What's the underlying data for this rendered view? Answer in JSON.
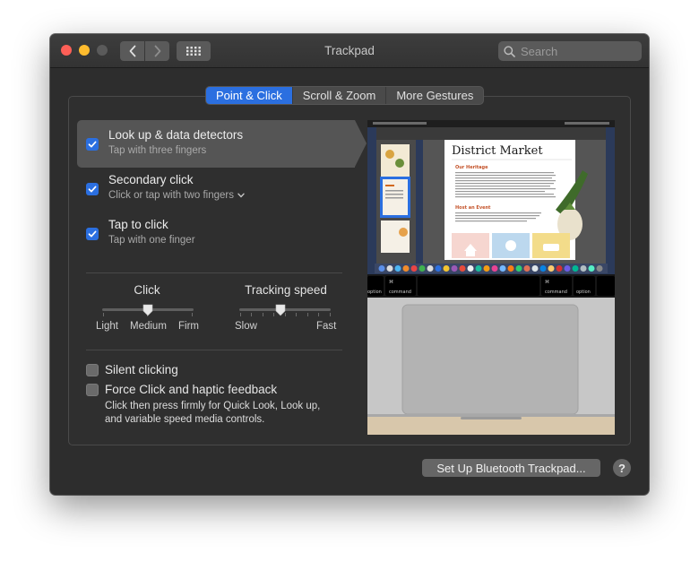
{
  "window": {
    "title": "Trackpad"
  },
  "toolbar": {
    "search_placeholder": "Search"
  },
  "tabs": [
    {
      "label": "Point & Click",
      "active": true
    },
    {
      "label": "Scroll & Zoom",
      "active": false
    },
    {
      "label": "More Gestures",
      "active": false
    }
  ],
  "options": [
    {
      "title": "Look up & data detectors",
      "subtitle": "Tap with three fingers",
      "checked": true,
      "selected": true
    },
    {
      "title": "Secondary click",
      "subtitle": "Click or tap with two fingers",
      "checked": true,
      "selected": false,
      "has_dropdown": true
    },
    {
      "title": "Tap to click",
      "subtitle": "Tap with one finger",
      "checked": true,
      "selected": false
    }
  ],
  "click_slider": {
    "title": "Click",
    "labels": [
      "Light",
      "Medium",
      "Firm"
    ],
    "value": 0.5
  },
  "tracking_slider": {
    "title": "Tracking speed",
    "labels": [
      "Slow",
      "Fast"
    ],
    "value": 0.45
  },
  "silent_clicking": {
    "label": "Silent clicking",
    "checked": false
  },
  "force_click": {
    "label": "Force Click and haptic feedback",
    "checked": false,
    "description_lines": [
      "Click then press firmly for Quick Look, Look up,",
      "and variable speed media controls."
    ]
  },
  "preview": {
    "doc_title": "District Market",
    "section1_heading": "Our Heritage",
    "section2_heading": "Host an Event",
    "thumb_text": "DISTRICT",
    "keys": {
      "left_option": "option",
      "left_command": "command",
      "right_command": "command",
      "right_option": "option"
    }
  },
  "footer": {
    "bluetooth_button": "Set Up Bluetooth Trackpad...",
    "help_label": "?"
  },
  "colors": {
    "accent": "#2b6fe0",
    "window_bg": "#2d2d2d"
  }
}
